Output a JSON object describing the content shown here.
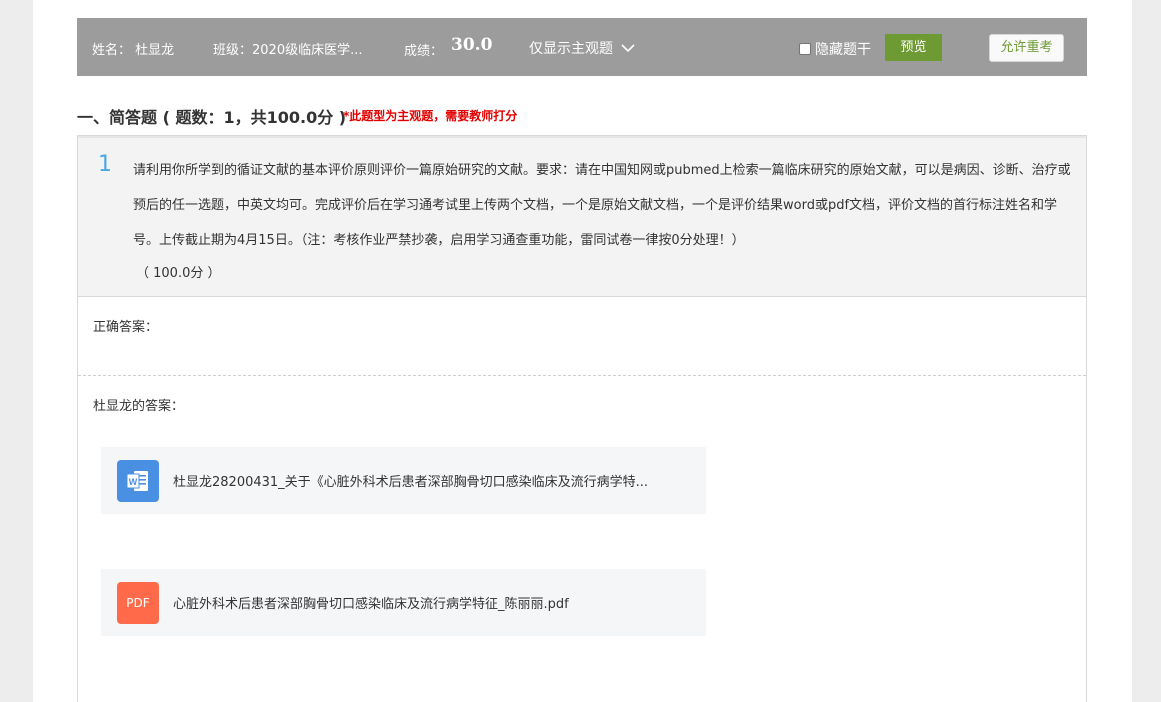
{
  "topbar": {
    "name": "姓名： 杜显龙",
    "class": "班级：2020级临床医学...",
    "score_label": "成绩：",
    "score_value": "30.0",
    "filter_label": "仅显示主观题",
    "hide_stem_label": "隐藏题干",
    "preview_label": "预览",
    "retake_label": "允许重考"
  },
  "section": {
    "title": "一、简答题 ( 题数：1，共100.0分 )",
    "note": "*此题型为主观题，需要教师打分"
  },
  "question": {
    "number": "1",
    "text": "请利用你所学到的循证文献的基本评价原则评价一篇原始研究的文献。要求：请在中国知网或pubmed上检索一篇临床研究的原始文献，可以是病因、诊断、治疗或预后的任一选题，中英文均可。完成评价后在学习通考试里上传两个文档，一个是原始文献文档，一个是评价结果word或pdf文档，评价文档的首行标注姓名和学号。上传截止期为4月15日。（注：考核作业严禁抄袭，启用学习通查重功能，雷同试卷一律按0分处理！）",
    "score": "（ 100.0分 ）"
  },
  "answers": {
    "correct_label": "正确答案：",
    "student_label": "杜显龙的答案："
  },
  "files": [
    {
      "icon": "word-file-icon",
      "glyph": "W",
      "name": "杜显龙28200431_关于《心脏外科术后患者深部胸骨切口感染临床及流行病学特..."
    },
    {
      "icon": "pdf-file-icon",
      "glyph": "PDF",
      "name": "心脏外科术后患者深部胸骨切口感染临床及流行病学特征_陈丽丽.pdf"
    }
  ],
  "colors": {
    "topbar_bg": "#9c9c9c",
    "preview_button": "#6d9a33",
    "question_number": "#4aa7e6",
    "note_red": "#e20000",
    "word_icon": "#4a90e2",
    "pdf_icon": "#ff6b4a"
  }
}
